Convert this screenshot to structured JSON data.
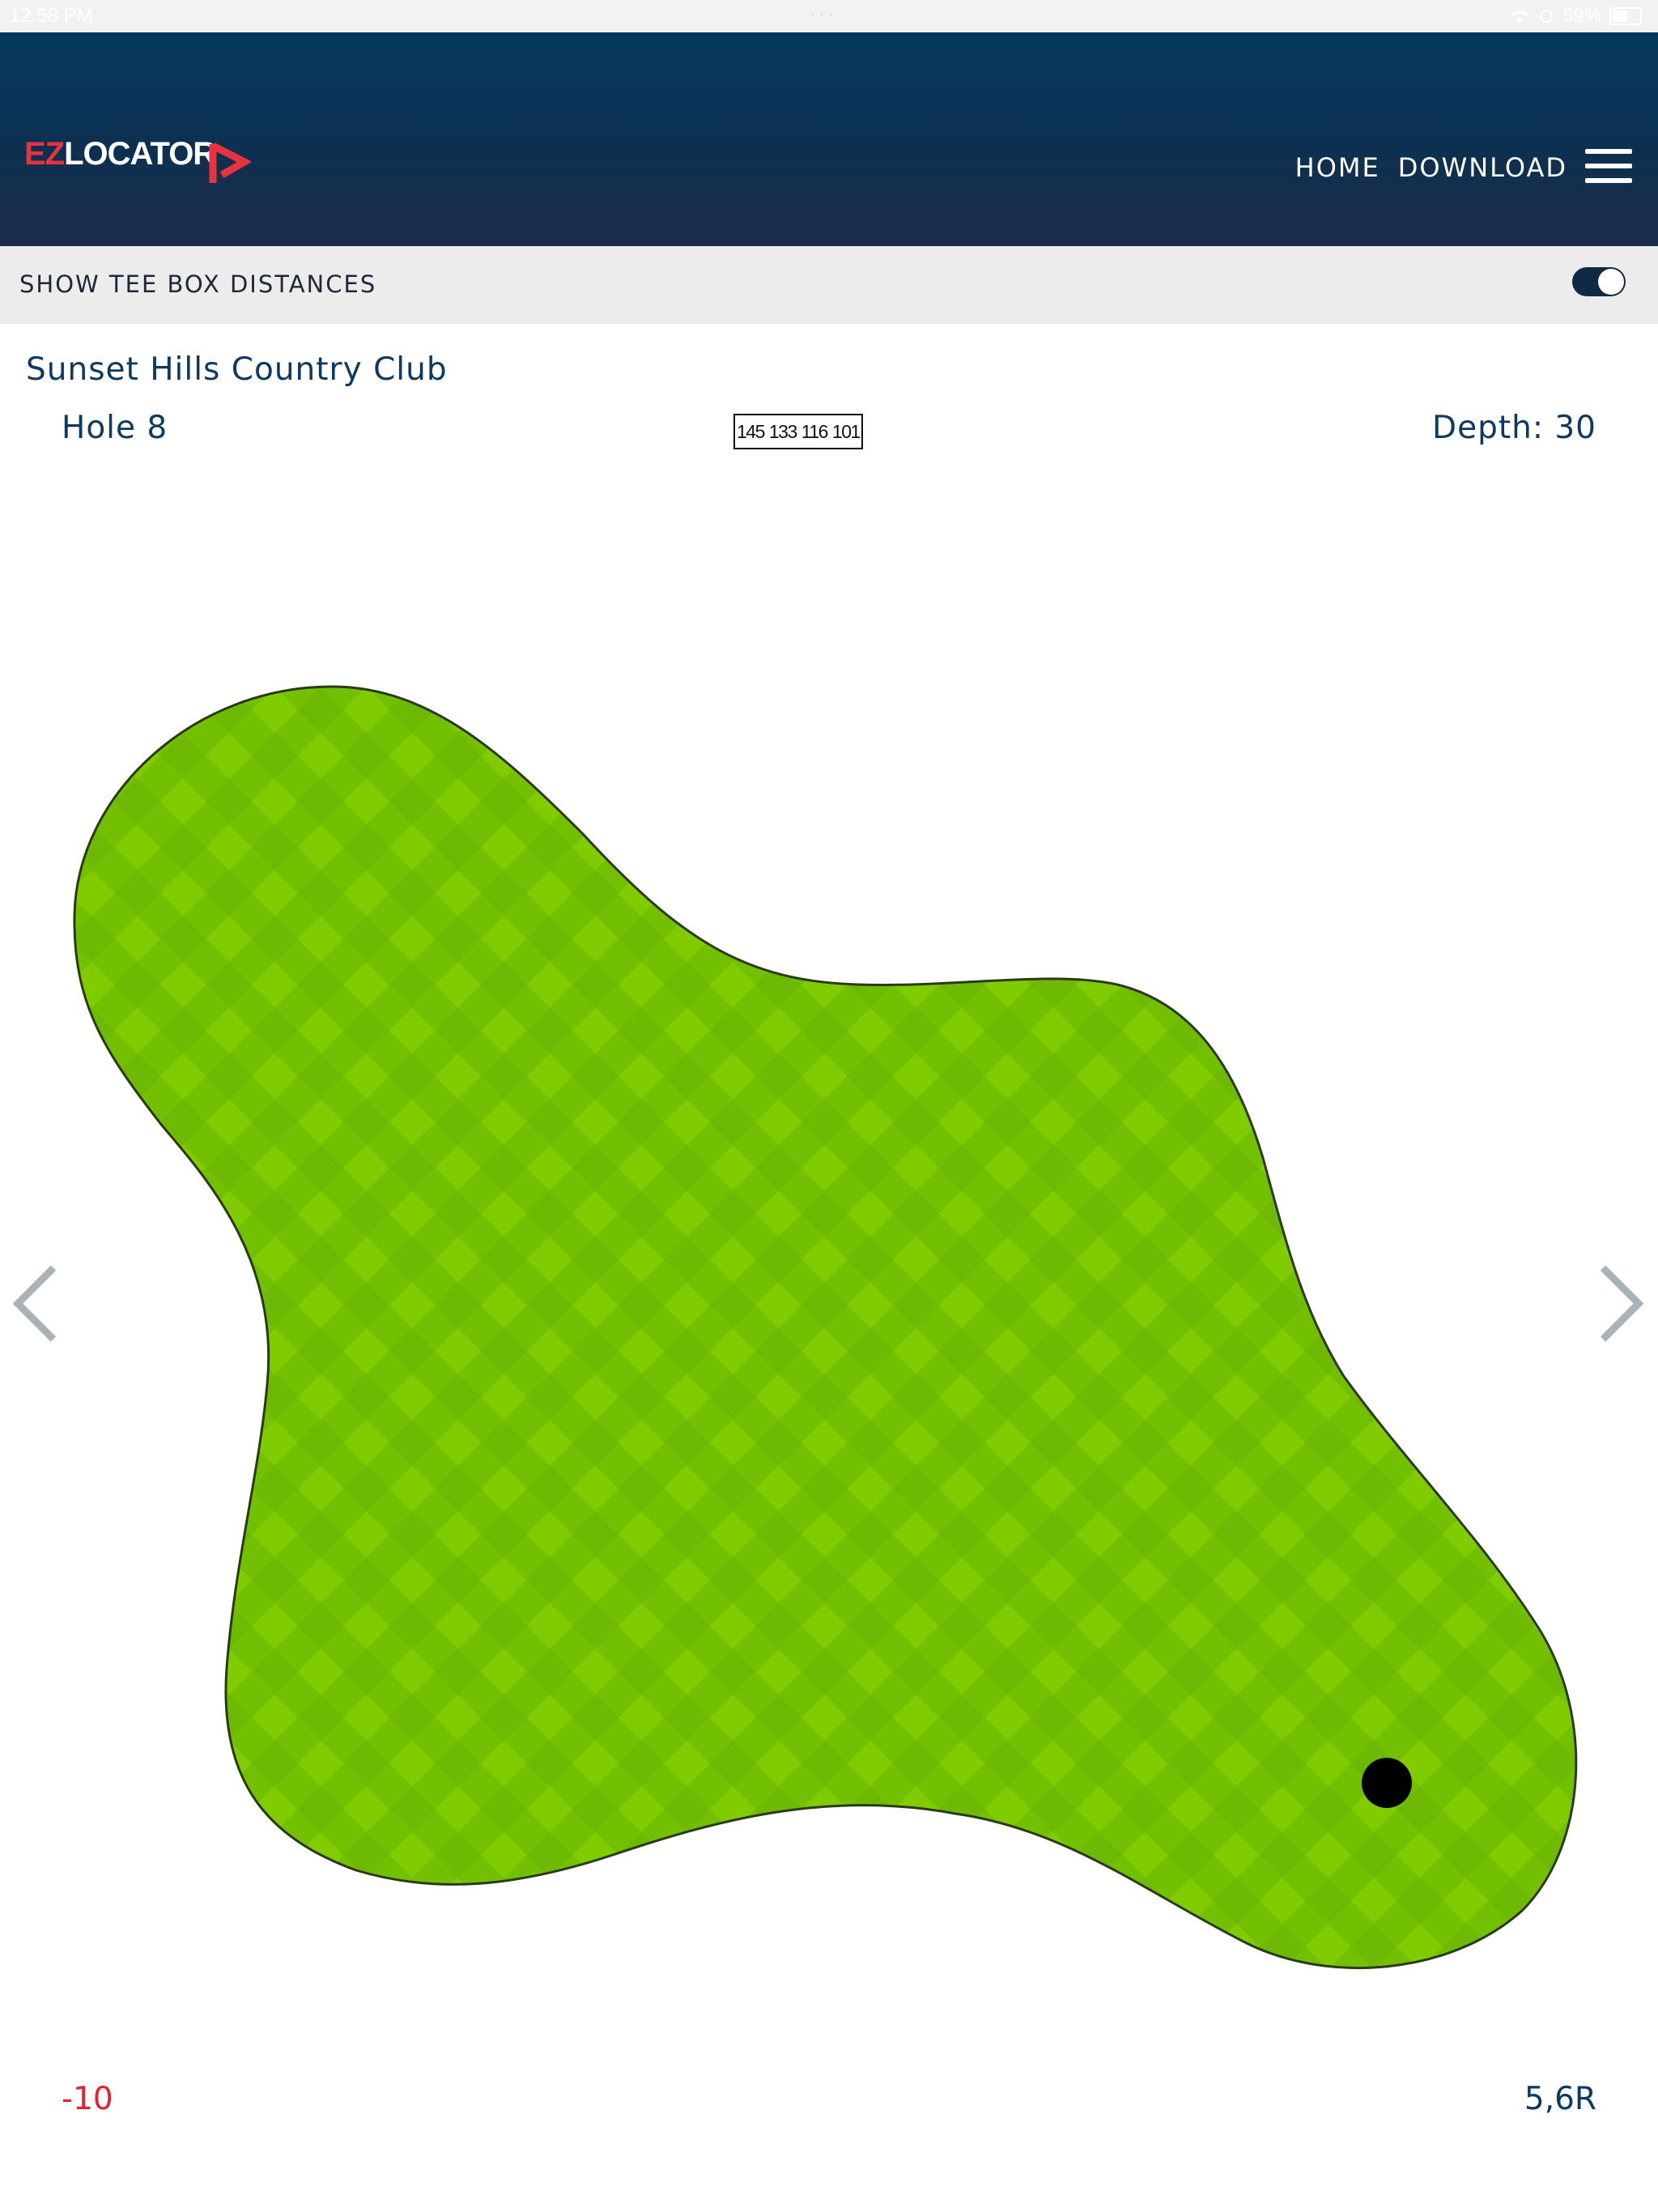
{
  "status_bar": {
    "time": "12:58 PM",
    "battery_text": "59%"
  },
  "header": {
    "logo_prefix": "EZ",
    "logo_suffix": "LOCATOR",
    "nav": [
      "HOME",
      "DOWNLOAD"
    ],
    "menu_icon": "hamburger-menu-icon"
  },
  "settings": {
    "tee_box_label": "SHOW TEE BOX DISTANCES",
    "tee_box_enabled": true
  },
  "course": {
    "club_name": "Sunset Hills Country Club",
    "hole_label": "Hole 8",
    "tee_distances": [
      "145",
      "133",
      "116",
      "101"
    ],
    "depth_label": "Depth: 30"
  },
  "green": {
    "fill_colors": [
      "#80cc00",
      "#5fa80a"
    ],
    "pin_color": "#000000"
  },
  "pin_position": {
    "offset_label": "-10",
    "location_label": "5,6R"
  },
  "colors": {
    "header_top": "#04385e",
    "header_bottom": "#1d2d48",
    "brand_red": "#e8323f",
    "text_navy": "#0c3a63",
    "arrow_gray": "#a8b3b8"
  }
}
